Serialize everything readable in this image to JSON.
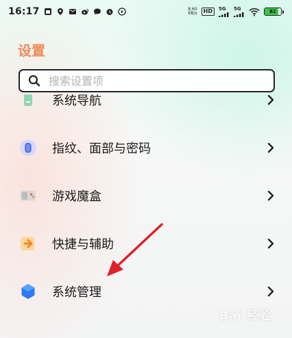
{
  "status_bar": {
    "time": "16:17",
    "net_speed_value": "8.60",
    "net_speed_unit": "KB/s",
    "hd_label": "HD",
    "sim1_label": "5G",
    "sim2_label": "5G",
    "battery_level": "82",
    "battery_fraction": 0.82
  },
  "page": {
    "title": "设置"
  },
  "search": {
    "placeholder": "搜索设置项",
    "value": ""
  },
  "settings_items": [
    {
      "label": "系统导航",
      "icon": "navigation-icon"
    },
    {
      "label": "指纹、面部与密码",
      "icon": "fingerprint-icon"
    },
    {
      "label": "游戏魔盒",
      "icon": "game-box-icon"
    },
    {
      "label": "快捷与辅助",
      "icon": "shortcut-icon"
    },
    {
      "label": "系统管理",
      "icon": "system-management-icon"
    }
  ],
  "watermark": {
    "text": "Bai 经验"
  },
  "colors": {
    "title": "#ef8a5a",
    "annotation_arrow": "#e0202a",
    "battery_fill": "#39c54a"
  }
}
